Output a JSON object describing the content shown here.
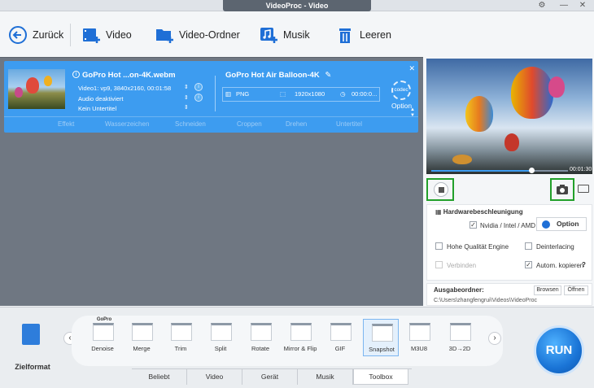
{
  "window": {
    "title": "VideoProc - Video",
    "settings_icon": "gear-icon",
    "minimize": "—",
    "close": "✕"
  },
  "toolbar": {
    "back_label": "Zurück",
    "video_label": "Video",
    "folder_label": "Video-Ordner",
    "music_label": "Musik",
    "clear_label": "Leeren"
  },
  "file_card": {
    "source_name": "GoPro Hot ...on-4K.webm",
    "video_info": "Video1: vp9, 3840x2160, 00:01:58",
    "audio": "Audio deaktiviert",
    "subtitle": "Kein Untertitel",
    "output_name": "GoPro Hot Air Balloon-4K",
    "output_format": "PNG",
    "output_resolution": "1920x1080",
    "output_duration": "00:00:0...",
    "codec_label": "codec",
    "option_label": "Option",
    "actions": [
      "Effekt",
      "Wasserzeichen",
      "Schneiden",
      "Croppen",
      "Drehen",
      "Untertitel"
    ]
  },
  "player": {
    "time": "00:01:30",
    "progress": 0.73
  },
  "hardware": {
    "heading": "Hardwarebeschleunigung",
    "gpu_label": "Nvidia / Intel / AMD",
    "gpu_checked": true,
    "option_button": "Option",
    "high_quality": "Hohe Qualität Engine",
    "high_quality_checked": false,
    "deinterlacing": "Deinterlacing",
    "deinterlacing_checked": false,
    "merge": "Verbinden",
    "merge_checked": false,
    "auto_copy": "Autom. kopieren",
    "auto_copy_checked": true,
    "help": "?"
  },
  "output": {
    "heading": "Ausgabeordner:",
    "browse": "Browsen",
    "open": "Öffnen",
    "path": "C:\\Users\\zhangfengrui\\Videos\\VideoProc"
  },
  "bottom": {
    "target_format": "Zielformat",
    "tools": [
      {
        "label": "Denoise",
        "badge": "GoPro"
      },
      {
        "label": "Merge"
      },
      {
        "label": "Trim"
      },
      {
        "label": "Split"
      },
      {
        "label": "Rotate"
      },
      {
        "label": "Mirror & Flip"
      },
      {
        "label": "GIF"
      },
      {
        "label": "Snapshot",
        "selected": true
      },
      {
        "label": "M3U8"
      },
      {
        "label": "3D→2D"
      }
    ],
    "tabs": [
      "Beliebt",
      "Video",
      "Gerät",
      "Musik",
      "Toolbox"
    ],
    "active_tab": "Toolbox",
    "run_label": "RUN"
  },
  "colors": {
    "accent": "#3d9cf0",
    "highlight": "#22a02a",
    "run": "#1a74d6"
  }
}
